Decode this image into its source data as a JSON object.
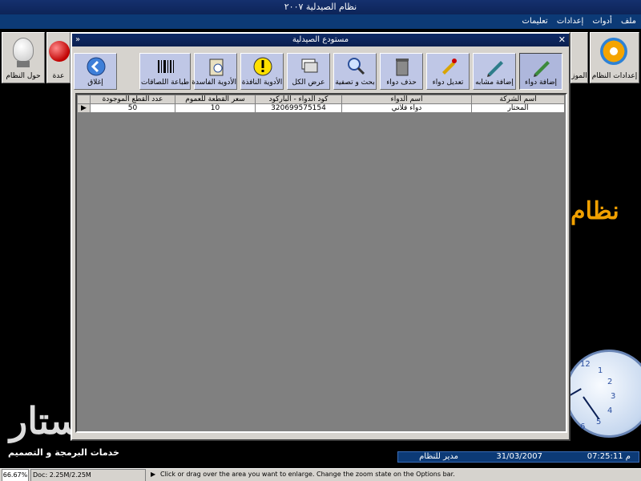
{
  "window": {
    "title": "نظام الصيدلية ٢٠٠٧"
  },
  "menu": {
    "items": [
      "ملف",
      "أدوات",
      "إعدادات",
      "تعليمات"
    ]
  },
  "side_buttons": {
    "about": "حول النظام",
    "partial": "عدة",
    "settings": "إعدادات النظام",
    "partial_right": "الموز"
  },
  "brand": "نظام",
  "logo": {
    "big": "ستار",
    "caption": "خدمات البرمجة و التصميم"
  },
  "clock": {
    "numbers": [
      "12",
      "1",
      "2",
      "3",
      "4",
      "5",
      "6"
    ]
  },
  "status_strip": {
    "time": "07:25:11 م",
    "date": "31/03/2007",
    "user": "مدير للنظام"
  },
  "dialog": {
    "title": "مستودع الصيدلية",
    "toolbar": [
      {
        "label": "إضافة دواء",
        "icon": "pen-add-icon",
        "active": true
      },
      {
        "label": "إضافة مشابه",
        "icon": "pen-similar-icon"
      },
      {
        "label": "تعديل دواء",
        "icon": "edit-pencil-icon"
      },
      {
        "label": "حذف دواء",
        "icon": "trash-icon"
      },
      {
        "label": "بحث و تصفية",
        "icon": "magnifier-icon"
      },
      {
        "label": "عرض الكل",
        "icon": "stack-icon"
      },
      {
        "label": "الأدوية النافذة",
        "icon": "warning-icon"
      },
      {
        "label": "الأدوية الفاسدة",
        "icon": "clipboard-icon"
      },
      {
        "label": "طباعة اللصاقات",
        "icon": "barcode-icon"
      },
      {
        "label": "إغلاق",
        "icon": "back-arrow-icon"
      }
    ],
    "table": {
      "columns": [
        "اسم الشركة",
        "اسم الدواء",
        "كود الدواء - الباركود",
        "سعر القطعة للعموم",
        "عدد القطع الموجودة"
      ],
      "rows": [
        [
          "المختار",
          "دواء فلاني",
          "320699575154",
          "10",
          "50"
        ]
      ]
    }
  },
  "bottom_bar": {
    "zoom": "66.67%",
    "doc": "Doc: 2.25M/2.25M",
    "message": "Click or drag over the area you want to enlarge. Change the zoom state on the Options bar."
  },
  "colors": {
    "title_bar": "#15306e",
    "dialog_bg": "#d6d3ce",
    "grid_bg": "#808080",
    "toolbar_btn": "#bfc7e6"
  }
}
